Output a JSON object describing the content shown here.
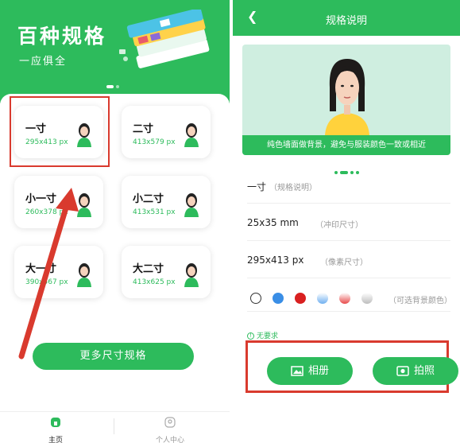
{
  "left": {
    "hero": {
      "title": "百种规格",
      "subtitle": "一应俱全"
    },
    "cards": [
      {
        "name": "一寸",
        "size": "295x413 px"
      },
      {
        "name": "二寸",
        "size": "413x579 px"
      },
      {
        "name": "小一寸",
        "size": "260x378 px"
      },
      {
        "name": "小二寸",
        "size": "413x531 px"
      },
      {
        "name": "大一寸",
        "size": "390x567 px"
      },
      {
        "name": "大二寸",
        "size": "413x625 px"
      }
    ],
    "more_button": "更多尺寸规格",
    "tabs": [
      {
        "label": "主页",
        "icon": "home-icon"
      },
      {
        "label": "个人中心",
        "icon": "user-icon"
      }
    ]
  },
  "right": {
    "nav": {
      "back_icon": "chevron-left-icon",
      "title": "规格说明"
    },
    "photo_caption": "纯色墙面做背景，避免与服装颜色一致或相近",
    "spec_rows": [
      {
        "value": "一寸",
        "hint": "（规格说明）"
      },
      {
        "value": "25x35 mm",
        "hint": "（冲印尺寸）"
      },
      {
        "value": "295x413 px",
        "hint": "（像素尺寸）"
      }
    ],
    "background_colors": [
      "#ffffff",
      "#3a8ee6",
      "#d92020",
      "#6fb0f0",
      "#e84a4a",
      "#bdbdbd"
    ],
    "colors_hint": "（可选背景颜色）",
    "requirement": "无要求",
    "buttons": {
      "album": "相册",
      "photo": "拍照"
    }
  },
  "colors": {
    "brand_green": "#2dbb5c",
    "highlight_red": "#d93a2e"
  }
}
